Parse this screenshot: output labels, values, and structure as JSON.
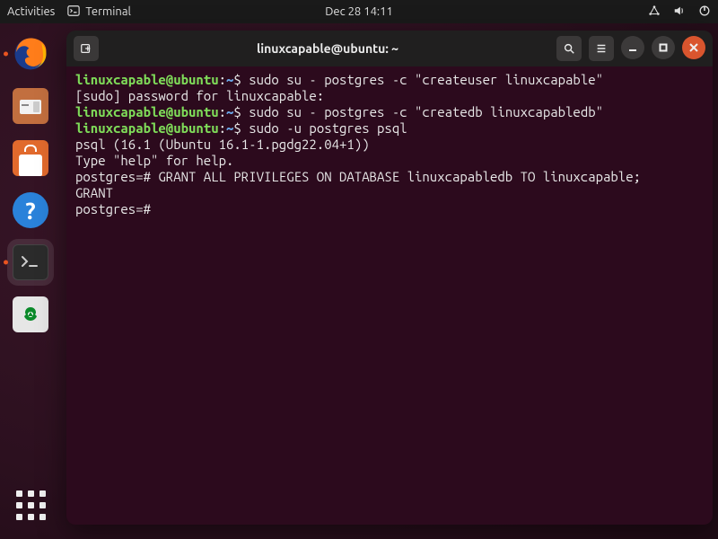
{
  "topbar": {
    "activities": "Activities",
    "terminal_label": "Terminal",
    "datetime": "Dec 28  14:11"
  },
  "dock": {
    "firefox": "Firefox",
    "files": "Files",
    "software": "Ubuntu Software",
    "help": "Help",
    "terminal": "Terminal",
    "trash": "Trash",
    "apps": "Show Applications"
  },
  "window": {
    "title": "linuxcapable@ubuntu: ~",
    "new_tab": "New Tab",
    "search": "Search",
    "menu": "Menu",
    "minimize": "Minimize",
    "maximize": "Maximize",
    "close": "Close"
  },
  "terminal": {
    "lines": [
      {
        "type": "prompt",
        "user": "linuxcapable@ubuntu",
        "path": "~",
        "cmd": "sudo su - postgres -c \"createuser linuxcapable\""
      },
      {
        "type": "plain",
        "text": "[sudo] password for linuxcapable:"
      },
      {
        "type": "prompt",
        "user": "linuxcapable@ubuntu",
        "path": "~",
        "cmd": "sudo su - postgres -c \"createdb linuxcapabledb\""
      },
      {
        "type": "prompt",
        "user": "linuxcapable@ubuntu",
        "path": "~",
        "cmd": "sudo -u postgres psql"
      },
      {
        "type": "plain",
        "text": "psql (16.1 (Ubuntu 16.1-1.pgdg22.04+1))"
      },
      {
        "type": "plain",
        "text": "Type \"help\" for help."
      },
      {
        "type": "plain",
        "text": ""
      },
      {
        "type": "plain",
        "text": "postgres=# GRANT ALL PRIVILEGES ON DATABASE linuxcapabledb TO linuxcapable;"
      },
      {
        "type": "plain",
        "text": "GRANT"
      },
      {
        "type": "plain",
        "text": "postgres=#"
      }
    ]
  }
}
